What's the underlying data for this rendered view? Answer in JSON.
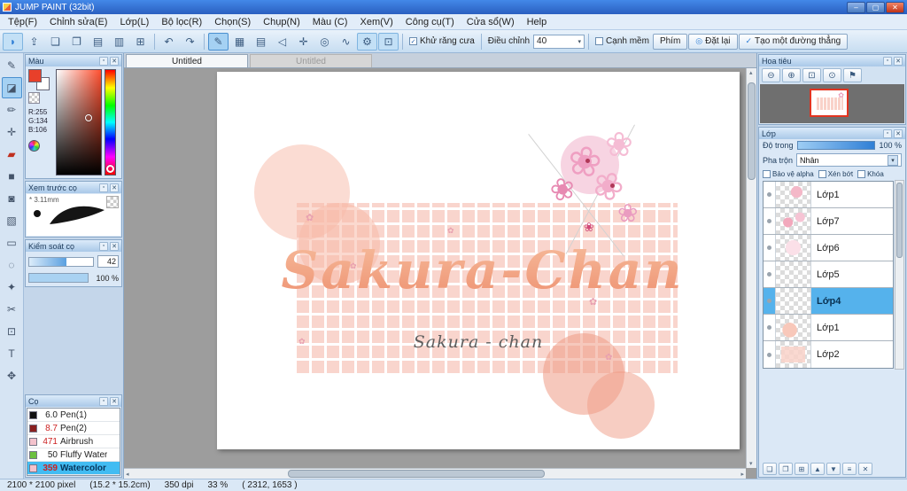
{
  "window": {
    "title": "JUMP PAINT (32bit)",
    "controls": {
      "min": "–",
      "max": "▢",
      "close": "✕"
    }
  },
  "menu": {
    "items": [
      "Tệp(F)",
      "Chỉnh sửa(E)",
      "Lớp(L)",
      "Bộ lọc(R)",
      "Chọn(S)",
      "Chụp(N)",
      "Màu (C)",
      "Xem(V)",
      "Công cụ(T)",
      "Cửa sổ(W)",
      "Help"
    ]
  },
  "toolbar": {
    "groupA": [
      {
        "glyph": "◗",
        "name": "cloud-brush"
      },
      {
        "glyph": "⇪",
        "name": "export"
      },
      {
        "glyph": "❏",
        "name": "comment"
      },
      {
        "glyph": "❐",
        "name": "chat"
      },
      {
        "glyph": "▤",
        "name": "panel-layout-1"
      },
      {
        "glyph": "▥",
        "name": "panel-layout-2"
      },
      {
        "glyph": "⊞",
        "name": "workspace"
      }
    ],
    "undo": "↶",
    "redo": "↷",
    "groupC": [
      {
        "glyph": "✎",
        "name": "brush-tool"
      },
      {
        "glyph": "▦",
        "name": "grid-tool"
      },
      {
        "glyph": "▤",
        "name": "lines-tool"
      },
      {
        "glyph": "◁",
        "name": "arrow-tool"
      },
      {
        "glyph": "✛",
        "name": "cross-tool"
      },
      {
        "glyph": "◎",
        "name": "circle-tool"
      },
      {
        "glyph": "∿",
        "name": "curve-tool"
      },
      {
        "glyph": "⚙",
        "name": "settings-tool"
      },
      {
        "glyph": "⊡",
        "name": "snap-tool"
      }
    ],
    "antialias": "Khử răng cưa",
    "adjust_label": "Điều chỉnh",
    "adjust_value": "40",
    "soft": "Cạnh mềm",
    "key": "Phím",
    "reset": "Đặt lại",
    "line": "Tạo một đường thẳng",
    "check_glyph": "✓",
    "dropdown_arrow": "▾"
  },
  "tools": {
    "items": [
      {
        "glyph": "✎",
        "name": "pen-tool"
      },
      {
        "glyph": "◪",
        "name": "eraser-tool"
      },
      {
        "glyph": "✏",
        "name": "pencil-tool"
      },
      {
        "glyph": "✛",
        "name": "move-tool"
      },
      {
        "glyph": "▰",
        "name": "red-brush-tool"
      },
      {
        "glyph": "■",
        "name": "shape-tool"
      },
      {
        "glyph": "◙",
        "name": "fill-tool"
      },
      {
        "glyph": "▧",
        "name": "gradient-tool"
      },
      {
        "glyph": "▭",
        "name": "select-rect-tool"
      },
      {
        "glyph": "◌",
        "name": "lasso-tool"
      },
      {
        "glyph": "✦",
        "name": "magic-wand-tool"
      },
      {
        "glyph": "✂",
        "name": "scissors-tool"
      },
      {
        "glyph": "⊡",
        "name": "stamp-tool"
      },
      {
        "glyph": "T",
        "name": "text-tool"
      },
      {
        "glyph": "✥",
        "name": "hand-tool"
      }
    ]
  },
  "panels": {
    "pop": "▫",
    "close": "✕"
  },
  "color": {
    "title": "Màu",
    "r": "R:255",
    "g": "G:134",
    "b": "B:106",
    "accent": "#e8402a"
  },
  "preview": {
    "title": "Xem trước cọ",
    "size": "3.11mm"
  },
  "control": {
    "title": "Kiểm soát cọ",
    "v1": "42",
    "v2": "100 %"
  },
  "brushes": {
    "title": "Cọ",
    "items": [
      {
        "size": "6.0",
        "name": "Pen(1)"
      },
      {
        "size": "8.7",
        "name": "Pen(2)"
      },
      {
        "size": "471",
        "name": "Airbrush"
      },
      {
        "size": "50",
        "name": "Fluffy Water"
      },
      {
        "size": "359",
        "name": "Watercolor"
      }
    ]
  },
  "canvas": {
    "tabs": [
      "Untitled",
      "Untitled"
    ],
    "art_title": "Sakura-Chan",
    "art_subtitle": "Sakura - chan",
    "flower_glyph": "❀",
    "sprinkle_glyph": "✿"
  },
  "navigator": {
    "title": "Hoa tiêu",
    "buttons": [
      {
        "glyph": "⊖",
        "name": "zoom-out"
      },
      {
        "glyph": "⊕",
        "name": "zoom-in"
      },
      {
        "glyph": "⊡",
        "name": "zoom-fit"
      },
      {
        "glyph": "⊙",
        "name": "zoom-actual"
      },
      {
        "glyph": "⚑",
        "name": "flag"
      }
    ]
  },
  "layers": {
    "title": "Lớp",
    "opacity_label": "Độ trong",
    "opacity_value": "100 %",
    "blend_label": "Pha trộn",
    "blend_value": "Nhân",
    "arrow": "▾",
    "checks": [
      "Bảo vệ alpha",
      "Xén bớt",
      "Khóa"
    ],
    "items": [
      {
        "name": "Lớp1"
      },
      {
        "name": "Lớp7"
      },
      {
        "name": "Lớp6"
      },
      {
        "name": "Lớp5"
      },
      {
        "name": "Lớp4"
      },
      {
        "name": "Lớp1"
      },
      {
        "name": "Lớp2"
      }
    ],
    "tools": [
      {
        "glyph": "❏",
        "name": "new-layer"
      },
      {
        "glyph": "❐",
        "name": "duplicate-layer"
      },
      {
        "glyph": "⊞",
        "name": "layer-folder"
      },
      {
        "glyph": "▲",
        "name": "move-layer-up"
      },
      {
        "glyph": "▼",
        "name": "move-layer-down"
      },
      {
        "glyph": "≡",
        "name": "merge-layer"
      },
      {
        "glyph": "✕",
        "name": "delete-layer"
      }
    ],
    "selection_color": "#55b2ec"
  },
  "status": {
    "size": "2100 * 2100 pixel",
    "cm": "(15.2 * 15.2cm)",
    "dpi": "350 dpi",
    "zoom": "33 %",
    "coords": "( 2312, 1653 )"
  }
}
